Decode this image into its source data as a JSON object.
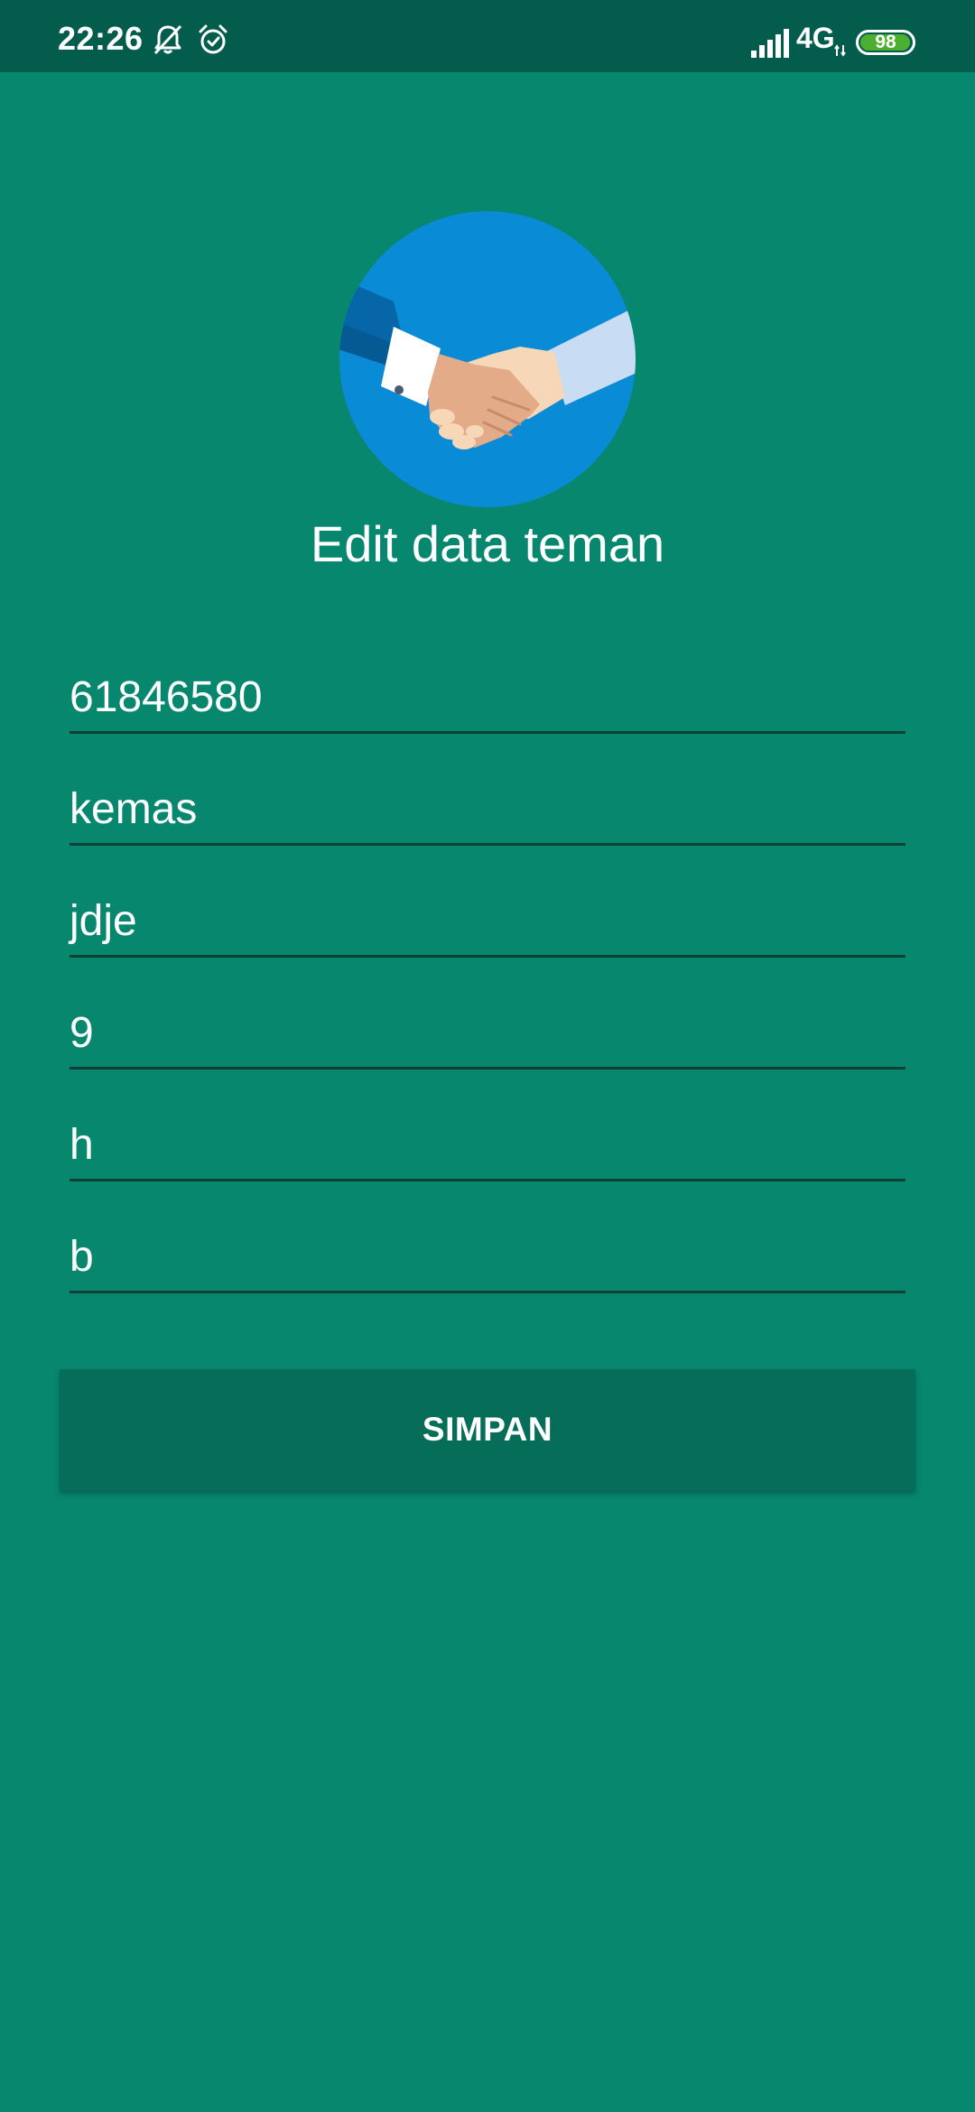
{
  "status_bar": {
    "time": "22:26",
    "network": "4G",
    "battery_level": "98",
    "battery_color": "#4caf2f",
    "icons": [
      "bell-off-icon",
      "alarm-icon",
      "signal-icon",
      "battery-icon"
    ]
  },
  "header": {
    "logo_icon": "handshake-icon",
    "title": "Edit data teman"
  },
  "form": {
    "fields": [
      {
        "value": "61846580"
      },
      {
        "value": "kemas"
      },
      {
        "value": "jdje"
      },
      {
        "value": "9"
      },
      {
        "value": "h"
      },
      {
        "value": "b"
      }
    ],
    "save_label": "SIMPAN"
  },
  "colors": {
    "background": "#07876e",
    "status_bar": "#045c4c",
    "button": "#056d58",
    "logo_circle": "#0a8bd6"
  }
}
